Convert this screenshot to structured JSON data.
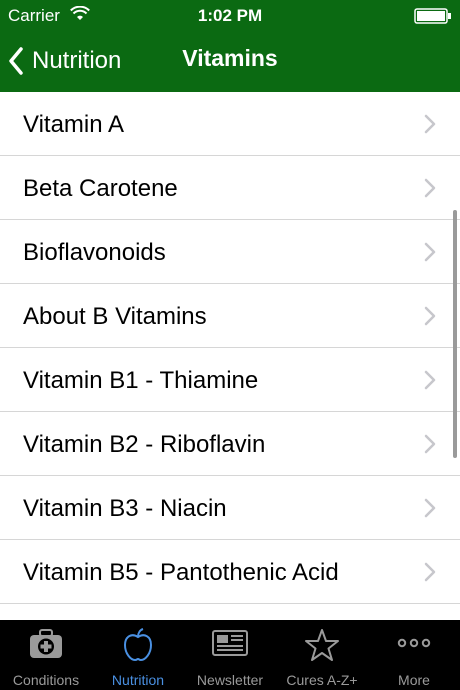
{
  "status_bar": {
    "carrier": "Carrier",
    "time": "1:02 PM"
  },
  "navbar": {
    "back_label": "Nutrition",
    "title": "Vitamins"
  },
  "list": {
    "items": [
      "Vitamin A",
      "Beta Carotene",
      "Bioflavonoids",
      "About B Vitamins",
      "Vitamin B1 - Thiamine",
      "Vitamin B2 - Riboflavin",
      "Vitamin B3 - Niacin",
      "Vitamin B5 - Pantothenic Acid",
      ""
    ]
  },
  "tabbar": {
    "tabs": [
      {
        "label": "Conditions",
        "icon": "first-aid-kit-icon",
        "active": false
      },
      {
        "label": "Nutrition",
        "icon": "apple-icon",
        "active": true
      },
      {
        "label": "Newsletter",
        "icon": "newspaper-icon",
        "active": false
      },
      {
        "label": "Cures A-Z+",
        "icon": "star-icon",
        "active": false
      },
      {
        "label": "More",
        "icon": "more-dots-icon",
        "active": false
      }
    ]
  },
  "colors": {
    "header_green": "#0b6a12",
    "active_blue": "#4a90e2",
    "inactive_gray": "#9a9a9a"
  }
}
